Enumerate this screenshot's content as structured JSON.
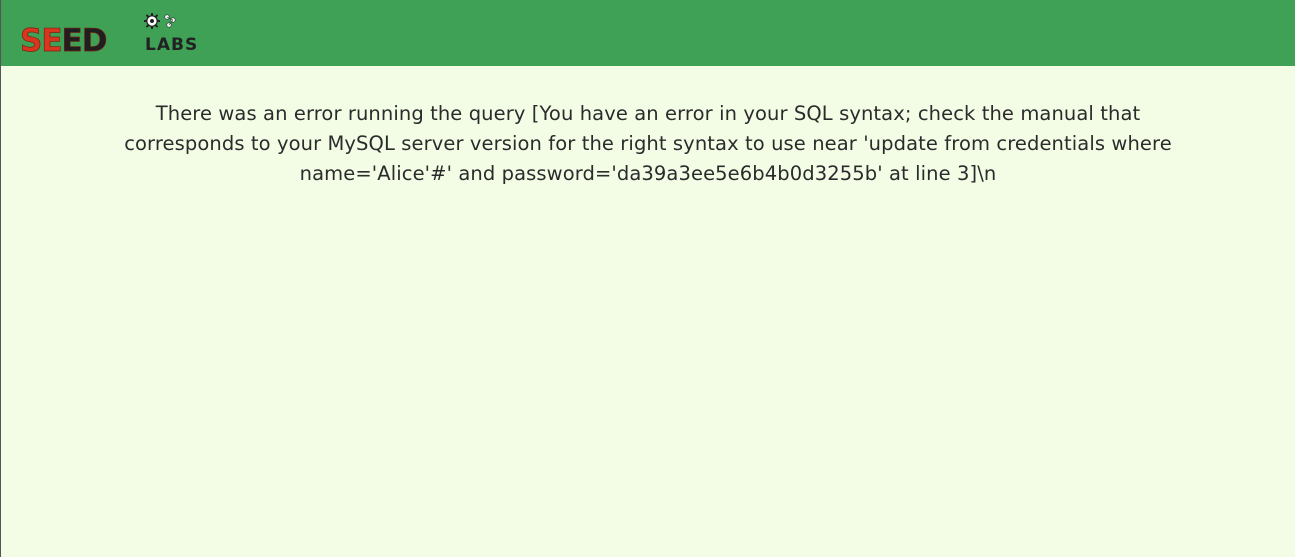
{
  "brand": {
    "logo_text_seed": "SEED",
    "logo_text_labs": "LABS",
    "colors": {
      "navbar": "#3ea155",
      "seed_red": "#d9361f",
      "labs_dark": "#222222",
      "background": "#f3fde6"
    }
  },
  "main": {
    "error_message": "There was an error running the query [You have an error in your SQL syntax; check the manual that corresponds to your MySQL server version for the right syntax to use near 'update from credentials where name='Alice'#' and password='da39a3ee5e6b4b0d3255b' at line 3]\\n"
  }
}
